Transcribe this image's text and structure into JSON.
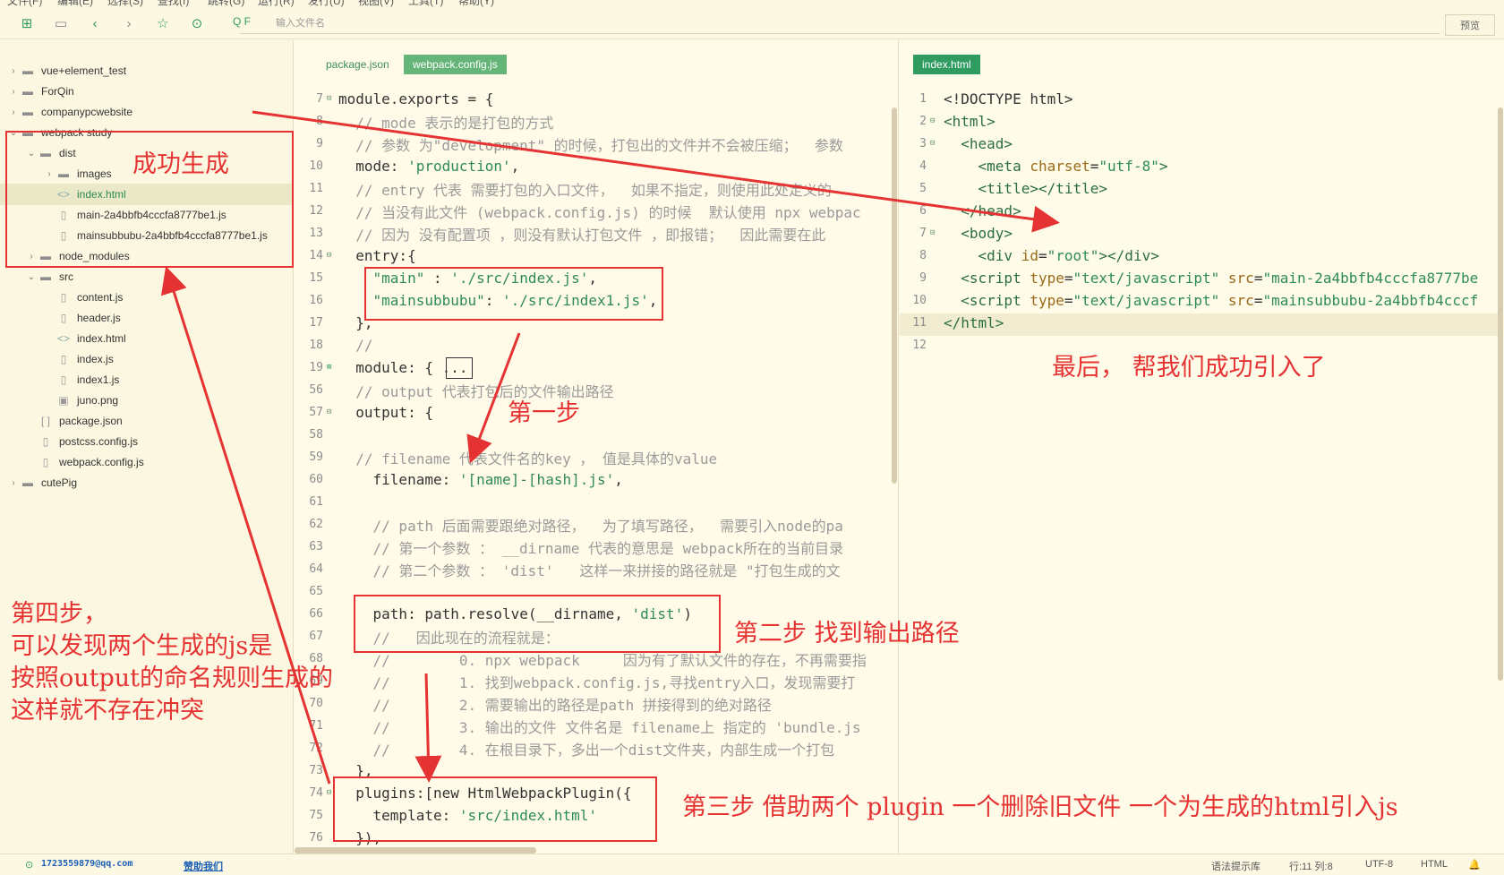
{
  "menubar": {
    "items": [
      "文件(F)",
      "编辑(E)",
      "选择(S)",
      "查找(I)",
      "跳转(G)",
      "运行(R)",
      "发行(U)",
      "视图(V)",
      "工具(T)",
      "帮助(Y)"
    ]
  },
  "toolbar": {
    "search_placeholder": "输入文件名",
    "search_prefix": "Q F",
    "preview_label": "预览",
    "icons": [
      "new-file-icon",
      "save-icon",
      "back-icon",
      "forward-icon",
      "star-icon",
      "run-icon"
    ]
  },
  "sidebar": {
    "items": [
      {
        "label": "vue+element_test",
        "type": "folder",
        "expanded": false
      },
      {
        "label": "ForQin",
        "type": "folder",
        "expanded": false
      },
      {
        "label": "companypcwebsite",
        "type": "folder",
        "expanded": false
      },
      {
        "label": "webpack study",
        "type": "folder",
        "expanded": true
      },
      {
        "label": "dist",
        "type": "folder",
        "expanded": true
      },
      {
        "label": "images",
        "type": "folder",
        "expanded": false
      },
      {
        "label": "index.html",
        "type": "html",
        "selected": true
      },
      {
        "label": "main-2a4bbfb4cccfa8777be1.js",
        "type": "file"
      },
      {
        "label": "mainsubbubu-2a4bbfb4cccfa8777be1.js",
        "type": "file"
      },
      {
        "label": "node_modules",
        "type": "folder",
        "expanded": false
      },
      {
        "label": "src",
        "type": "folder",
        "expanded": true
      },
      {
        "label": "content.js",
        "type": "file"
      },
      {
        "label": "header.js",
        "type": "file"
      },
      {
        "label": "index.html",
        "type": "html"
      },
      {
        "label": "index.js",
        "type": "file"
      },
      {
        "label": "index1.js",
        "type": "file"
      },
      {
        "label": "juno.png",
        "type": "image"
      },
      {
        "label": "package.json",
        "type": "json"
      },
      {
        "label": "postcss.config.js",
        "type": "file"
      },
      {
        "label": "webpack.config.js",
        "type": "file"
      },
      {
        "label": "cutePig",
        "type": "folder",
        "expanded": false
      }
    ]
  },
  "editor_left": {
    "tabs": [
      {
        "label": "package.json",
        "active": false
      },
      {
        "label": "webpack.config.js",
        "active": true
      }
    ],
    "lines": [
      {
        "n": "7",
        "fold": "⊟",
        "parts": [
          [
            "c-plain",
            "module.exports = {"
          ]
        ]
      },
      {
        "n": "8",
        "parts": [
          [
            "c-com",
            "  // mode 表示的是打包的方式"
          ]
        ]
      },
      {
        "n": "9",
        "parts": [
          [
            "c-com",
            "  // 参数 为\"development\" 的时候，打包出的文件并不会被压缩；  参数"
          ]
        ]
      },
      {
        "n": "10",
        "parts": [
          [
            "c-plain",
            "  mode: "
          ],
          [
            "c-str",
            "'production'"
          ],
          [
            "c-plain",
            ","
          ]
        ]
      },
      {
        "n": "11",
        "parts": [
          [
            "c-com",
            "  // entry 代表 需要打包的入口文件，  如果不指定，则使用此处定义的"
          ]
        ]
      },
      {
        "n": "12",
        "parts": [
          [
            "c-com",
            "  // 当没有此文件 (webpack.config.js) 的时候  默认使用 npx webpac"
          ]
        ]
      },
      {
        "n": "13",
        "parts": [
          [
            "c-com",
            "  // 因为 没有配置项 ，则没有默认打包文件 ，即报错；  因此需要在此"
          ]
        ]
      },
      {
        "n": "14",
        "fold": "⊟",
        "parts": [
          [
            "c-plain",
            "  entry:{"
          ]
        ]
      },
      {
        "n": "15",
        "parts": [
          [
            "c-str",
            "    \"main\""
          ],
          [
            "c-plain",
            " : "
          ],
          [
            "c-str",
            "'./src/index.js'"
          ],
          [
            "c-plain",
            ","
          ]
        ]
      },
      {
        "n": "16",
        "parts": [
          [
            "c-str",
            "    \"mainsubbubu\""
          ],
          [
            "c-plain",
            ": "
          ],
          [
            "c-str",
            "'./src/index1.js'"
          ],
          [
            "c-plain",
            ","
          ]
        ]
      },
      {
        "n": "17",
        "parts": [
          [
            "c-plain",
            "  },"
          ]
        ]
      },
      {
        "n": "18",
        "parts": [
          [
            "c-com",
            "  //"
          ]
        ]
      },
      {
        "n": "19",
        "fold": "⊞",
        "parts": [
          [
            "c-plain",
            "  module: { "
          ],
          [
            "c-plain",
            "..."
          ]
        ]
      },
      {
        "n": "56",
        "parts": [
          [
            "c-com",
            "  // output 代表打包后的文件输出路径"
          ]
        ]
      },
      {
        "n": "57",
        "fold": "⊟",
        "parts": [
          [
            "c-plain",
            "  output: {"
          ]
        ]
      },
      {
        "n": "58",
        "parts": [
          [
            "c-plain",
            ""
          ]
        ]
      },
      {
        "n": "59",
        "parts": [
          [
            "c-com",
            "  // filename 代表文件名的key ， 值是具体的value"
          ]
        ]
      },
      {
        "n": "60",
        "parts": [
          [
            "c-plain",
            "    filename: "
          ],
          [
            "c-str",
            "'[name]-[hash].js'"
          ],
          [
            "c-plain",
            ","
          ]
        ]
      },
      {
        "n": "61",
        "parts": [
          [
            "c-plain",
            ""
          ]
        ]
      },
      {
        "n": "62",
        "parts": [
          [
            "c-com",
            "    // path 后面需要跟绝对路径，  为了填写路径，  需要引入node的pa"
          ]
        ]
      },
      {
        "n": "63",
        "parts": [
          [
            "c-com",
            "    // 第一个参数 ： __dirname 代表的意思是 webpack所在的当前目录"
          ]
        ]
      },
      {
        "n": "64",
        "parts": [
          [
            "c-com",
            "    // 第二个参数 ： 'dist'   这样一来拼接的路径就是 \"打包生成的文"
          ]
        ]
      },
      {
        "n": "65",
        "parts": [
          [
            "c-plain",
            ""
          ]
        ]
      },
      {
        "n": "66",
        "parts": [
          [
            "c-plain",
            "    path: path.resolve(__dirname, "
          ],
          [
            "c-str",
            "'dist'"
          ],
          [
            "c-plain",
            ")"
          ]
        ]
      },
      {
        "n": "67",
        "parts": [
          [
            "c-com",
            "    //   因此现在的流程就是："
          ]
        ]
      },
      {
        "n": "68",
        "parts": [
          [
            "c-com",
            "    //        0. npx webpack     因为有了默认文件的存在，不再需要指"
          ]
        ]
      },
      {
        "n": "69",
        "parts": [
          [
            "c-com",
            "    //        1. 找到webpack.config.js,寻找entry入口，发现需要打"
          ]
        ]
      },
      {
        "n": "70",
        "parts": [
          [
            "c-com",
            "    //        2. 需要输出的路径是path 拼接得到的绝对路径"
          ]
        ]
      },
      {
        "n": "71",
        "parts": [
          [
            "c-com",
            "    //        3. 输出的文件 文件名是 filename上 指定的 'bundle.js"
          ]
        ]
      },
      {
        "n": "72",
        "parts": [
          [
            "c-com",
            "    //        4. 在根目录下，多出一个dist文件夹，内部生成一个打包"
          ]
        ]
      },
      {
        "n": "73",
        "parts": [
          [
            "c-plain",
            "  },"
          ]
        ]
      },
      {
        "n": "74",
        "fold": "⊟",
        "parts": [
          [
            "c-plain",
            "  plugins:[new HtmlWebpackPlugin({"
          ]
        ]
      },
      {
        "n": "75",
        "parts": [
          [
            "c-plain",
            "    template: "
          ],
          [
            "c-str",
            "'src/index.html'"
          ]
        ]
      },
      {
        "n": "76",
        "parts": [
          [
            "c-plain",
            "  }),"
          ]
        ]
      }
    ]
  },
  "editor_right": {
    "tabs": [
      {
        "label": "index.html",
        "active": true
      }
    ],
    "lines": [
      {
        "n": "1",
        "parts": [
          [
            "c-plain",
            "<!DOCTYPE html>"
          ]
        ]
      },
      {
        "n": "2",
        "fold": "⊟",
        "parts": [
          [
            "c-tag",
            "<html>"
          ]
        ]
      },
      {
        "n": "3",
        "fold": "⊟",
        "parts": [
          [
            "c-tag",
            "  <head>"
          ]
        ]
      },
      {
        "n": "4",
        "parts": [
          [
            "c-tag",
            "    <meta "
          ],
          [
            "c-attr",
            "charset"
          ],
          [
            "c-plain",
            "="
          ],
          [
            "c-str",
            "\"utf-8\""
          ],
          [
            "c-tag",
            ">"
          ]
        ]
      },
      {
        "n": "5",
        "parts": [
          [
            "c-tag",
            "    <title></title>"
          ]
        ]
      },
      {
        "n": "6",
        "parts": [
          [
            "c-tag",
            "  </head>"
          ]
        ]
      },
      {
        "n": "7",
        "fold": "⊟",
        "parts": [
          [
            "c-tag",
            "  <body>"
          ]
        ]
      },
      {
        "n": "8",
        "parts": [
          [
            "c-tag",
            "    <div "
          ],
          [
            "c-attr",
            "id"
          ],
          [
            "c-plain",
            "="
          ],
          [
            "c-str",
            "\"root\""
          ],
          [
            "c-tag",
            "></div>"
          ]
        ]
      },
      {
        "n": "9",
        "parts": [
          [
            "c-tag",
            "  <script "
          ],
          [
            "c-attr",
            "type"
          ],
          [
            "c-plain",
            "="
          ],
          [
            "c-str",
            "\"text/javascript\""
          ],
          [
            "c-plain",
            " "
          ],
          [
            "c-attr",
            "src"
          ],
          [
            "c-plain",
            "="
          ],
          [
            "c-str",
            "\"main-2a4bbfb4cccfa8777be"
          ]
        ]
      },
      {
        "n": "10",
        "parts": [
          [
            "c-tag",
            "  <script "
          ],
          [
            "c-attr",
            "type"
          ],
          [
            "c-plain",
            "="
          ],
          [
            "c-str",
            "\"text/javascript\""
          ],
          [
            "c-plain",
            " "
          ],
          [
            "c-attr",
            "src"
          ],
          [
            "c-plain",
            "="
          ],
          [
            "c-str",
            "\"mainsubbubu-2a4bbfb4cccf"
          ]
        ]
      },
      {
        "n": "11",
        "parts": [
          [
            "c-tag",
            "</html>"
          ]
        ]
      },
      {
        "n": "12",
        "parts": [
          [
            "c-plain",
            ""
          ]
        ]
      }
    ]
  },
  "annotations": {
    "success": "成功生成",
    "step1": "第一步",
    "step2": "第二步  找到输出路径",
    "step3": "第三步  借助两个  plugin  一个删除旧文件  一个为生成的html引入js",
    "step4_lines": [
      "第四步，",
      "可以发现两个生成的js是",
      "按照output的命名规则生成的",
      "这样就不存在冲突"
    ],
    "final": "最后，  帮我们成功引入了"
  },
  "statusbar": {
    "account": "1723559879@qq.com",
    "help": "赞助我们",
    "hint": "语法提示库",
    "position": "行:11  列:8",
    "encoding": "UTF-8",
    "language": "HTML"
  },
  "colors": {
    "accent": "#2e9c5e",
    "annotation": "#e53333",
    "background": "#fffbe8"
  }
}
